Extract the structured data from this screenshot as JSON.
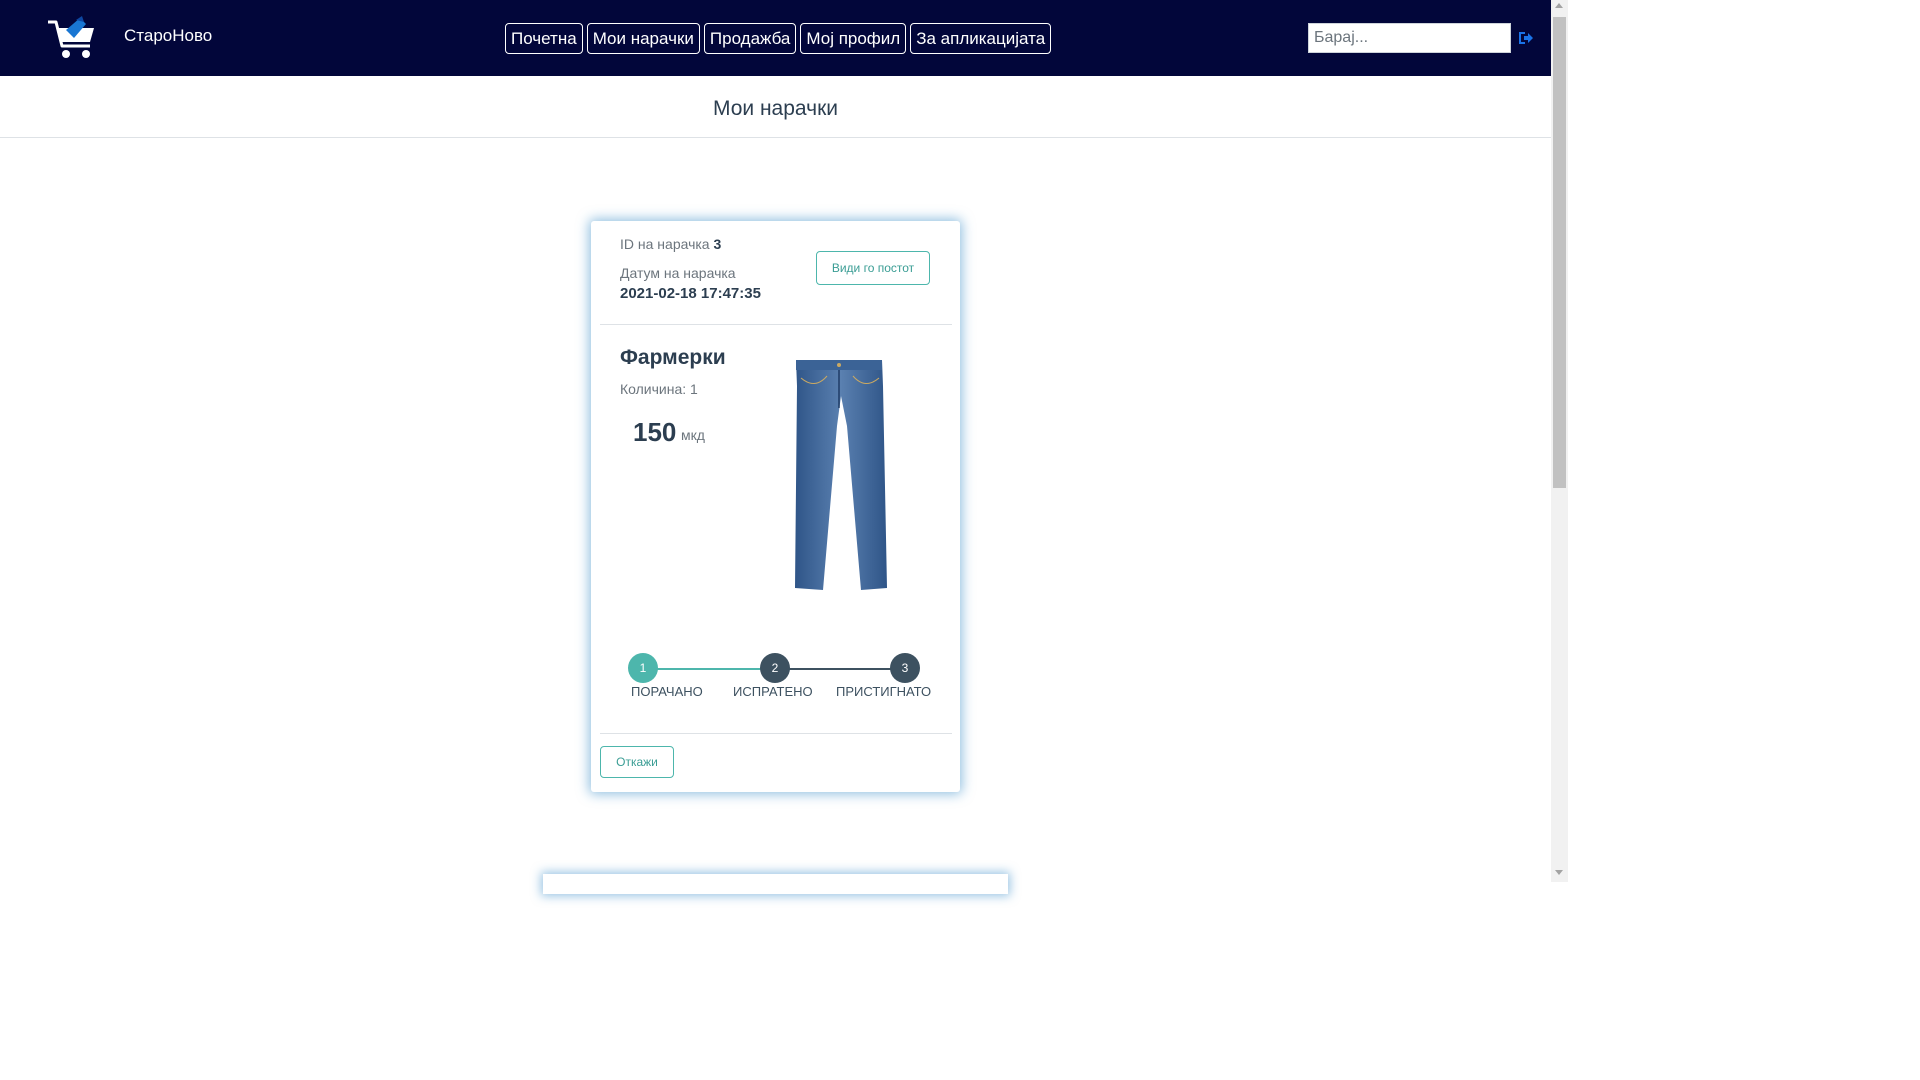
{
  "navbar": {
    "brand": "СтароНово",
    "links": [
      {
        "label": "Почетна"
      },
      {
        "label": "Мои нарачки"
      },
      {
        "label": "Продажба"
      },
      {
        "label": "Мој профил"
      },
      {
        "label": "За апликацијата"
      }
    ],
    "search_placeholder": "Барај...",
    "icons": {
      "logo": "shopping-cart-logo-icon",
      "signout": "sign-out-icon"
    },
    "background_color": "#02063a"
  },
  "page": {
    "title": "Мои нарачки"
  },
  "order": {
    "id_label": "ID на нарачка",
    "id_value": "3",
    "date_label": "Датум на нарачка",
    "date_value": "2021-02-18 17:47:35",
    "view_post_label": "Види го постот",
    "product": {
      "name": "Фармерки",
      "quantity_text": "Количина: 1",
      "price": "150",
      "currency": "мкд",
      "image": "jeans-image"
    },
    "progress": {
      "current_step": 1,
      "steps": [
        {
          "number": "1",
          "label": "ПОРАЧАНО"
        },
        {
          "number": "2",
          "label": "ИСПРАТЕНО"
        },
        {
          "number": "3",
          "label": "ПРИСТИГНАТО"
        }
      ]
    },
    "cancel_label": "Откажи"
  },
  "colors": {
    "accent": "#4db6ac",
    "step_inactive": "#3d5160",
    "card_shadow": "#348ac7"
  }
}
